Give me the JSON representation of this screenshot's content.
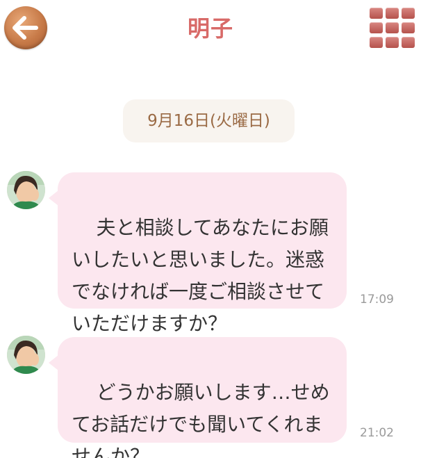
{
  "header": {
    "back_icon": "back-arrow-icon",
    "title": "明子",
    "menu_icon": "grid-menu-icon"
  },
  "date_separator": "9月16日(火曜日)",
  "messages": [
    {
      "sender": "明子",
      "avatar_icon": "avatar",
      "text": "夫と相談してあなたにお願いしたいと思いました。迷惑でなければ一度ご相談させていただけますか？",
      "time": "17:09"
    },
    {
      "sender": "明子",
      "avatar_icon": "avatar",
      "text": "どうかお願いします…せめてお話だけでも聞いてくれませんか？",
      "time": "21:02"
    }
  ],
  "colors": {
    "title": "#d86a68",
    "bubble": "#fce7ef",
    "date_pill_bg": "#f8f4ef",
    "date_text": "#9a6a44",
    "timestamp": "#9a9a9a"
  }
}
